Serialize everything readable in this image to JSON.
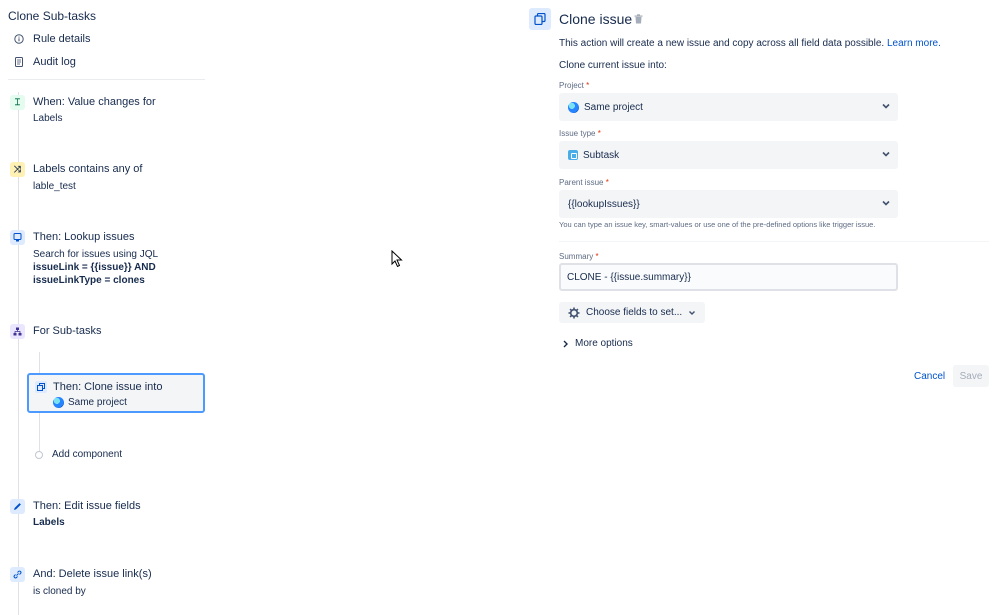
{
  "sidebar": {
    "rule_title": "Clone Sub-tasks",
    "links": [
      {
        "label": "Rule details",
        "icon": "info-icon"
      },
      {
        "label": "Audit log",
        "icon": "document-icon"
      }
    ]
  },
  "components": {
    "trigger": {
      "title": "When: Value changes for",
      "sub": "Labels",
      "icon": "trigger-icon"
    },
    "condition": {
      "title": "Labels contains any of",
      "sub": "lable_test",
      "icon": "condition-shuffle-icon"
    },
    "lookup": {
      "title": "Then: Lookup issues",
      "sub1": "Search for issues using JQL",
      "sub2": "issueLink = {{issue}} AND",
      "sub3": "issueLinkType = clones",
      "icon": "lookup-icon"
    },
    "branch": {
      "title": "For Sub-tasks",
      "icon": "branch-icon"
    },
    "clone": {
      "title": "Then: Clone issue into",
      "sub": "Same project",
      "icon": "clone-icon"
    },
    "add_component": "Add component",
    "edit": {
      "title": "Then: Edit issue fields",
      "sub": "Labels",
      "icon": "pencil-icon"
    },
    "delete_link": {
      "title": "And: Delete issue link(s)",
      "sub": "is cloned by",
      "icon": "unlink-icon"
    }
  },
  "panel": {
    "title": "Clone issue",
    "description": "This action will create a new issue and copy across all field data possible.",
    "learn_more": "Learn more.",
    "clone_into": "Clone current issue into:",
    "project": {
      "label": "Project",
      "required": "*",
      "value": "Same project"
    },
    "issue_type": {
      "label": "Issue type",
      "required": "*",
      "value": "Subtask"
    },
    "parent_issue": {
      "label": "Parent issue",
      "required": "*",
      "value": "{{lookupIssues}}"
    },
    "helper": "You can type an issue key, smart-values or use one of the pre-defined options like trigger issue.",
    "summary": {
      "label": "Summary",
      "required": "*",
      "value": "CLONE - {{issue.summary}}"
    },
    "choose_fields": "Choose fields to set...",
    "more_options": "More options",
    "cancel": "Cancel",
    "save": "Save"
  },
  "colors": {
    "accent": "#0052cc",
    "selected_border": "#4c9aff",
    "field_bg": "#f4f5f7"
  }
}
